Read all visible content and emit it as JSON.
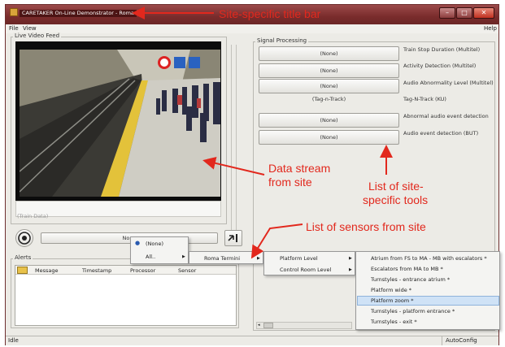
{
  "window": {
    "title": "CARETAKER On-Line Demonstrator - Roma",
    "buttons": {
      "minimize": "–",
      "maximize": "□",
      "close": "✕"
    }
  },
  "menu": {
    "file": "File",
    "view": "View",
    "help": "Help"
  },
  "live_video": {
    "label": "Live Video Feed",
    "train_data": "(Train Data)"
  },
  "signal_processing": {
    "label": "Signal Processing",
    "tools": [
      {
        "button": "(None)",
        "label": "Train Stop Duration (Multitel)"
      },
      {
        "button": "(None)",
        "label": "Activity Detection (Multitel)"
      },
      {
        "button": "(None)",
        "label": "Audio Abnormality Level (Multitel)"
      },
      {
        "button": "(Tag-n-Track)",
        "label": "Tag-N-Track (KU)"
      },
      {
        "button": "(None)",
        "label": "Abnormal audio event detection"
      },
      {
        "button": "(None)",
        "label": "Audio event detection (BUT)"
      }
    ]
  },
  "sensor_bar": {
    "value": "None"
  },
  "alerts": {
    "label": "Alerts",
    "columns": [
      "Message",
      "Timestamp",
      "Processor",
      "Sensor"
    ]
  },
  "dropdown": {
    "level1": [
      {
        "label": "(None)",
        "selected": true
      },
      {
        "label": "All..",
        "submenu": true
      }
    ],
    "level2": [
      {
        "label": "Roma Termini",
        "submenu": true
      }
    ],
    "level3": [
      {
        "label": "Platform Level",
        "submenu": true
      },
      {
        "label": "Control Room Level",
        "submenu": true
      }
    ],
    "level4": [
      "Atrium from FS to MA - MB with escalators *",
      "Escalators from MA to MB *",
      "Turnstyles - entrance atrium *",
      "Platform wide *",
      "Platform zoom *",
      "Turnstyles - platform entrance *",
      "Turnstyles - exit *"
    ],
    "highlighted": "Platform zoom *"
  },
  "status": {
    "left": "Idle",
    "right": "AutoConfig"
  },
  "annotations": {
    "title_bar": "Site-specific title bar",
    "data_stream": [
      "Data stream",
      "from site"
    ],
    "tools": [
      "List of site-",
      "specific tools"
    ],
    "sensors": "List of sensors from site"
  },
  "icons": {
    "sensor": "camera-dial-icon",
    "connect": "plug-icon"
  },
  "colors": {
    "annotation": "#e2281d",
    "titlebar": "#7a2c2c",
    "highlight": "#cfe2f6"
  }
}
